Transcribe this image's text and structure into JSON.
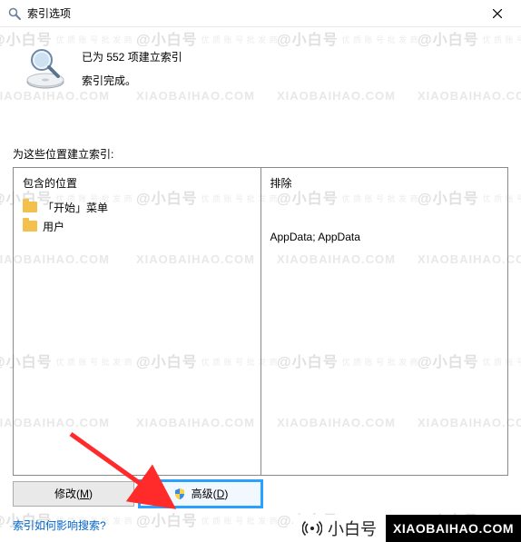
{
  "title": "索引选项",
  "status": {
    "line1": "已为 552 项建立索引",
    "line2": "索引完成。"
  },
  "section_label": "为这些位置建立索引:",
  "columns": {
    "included_header": "包含的位置",
    "excluded_header": "排除"
  },
  "included_locations": [
    {
      "label": "「开始」菜单"
    },
    {
      "label": "用户"
    }
  ],
  "excluded_text": "AppData; AppData",
  "buttons": {
    "modify": {
      "prefix": "修改(",
      "hotkey": "M",
      "suffix": ")"
    },
    "advanced": {
      "prefix": "高级(",
      "hotkey": "D",
      "suffix": ")"
    }
  },
  "help_link": "索引如何影响搜索?",
  "watermark": {
    "name": "@小白号",
    "tagline": "优 质 账 号 批 发 商",
    "url": "XIAOBAIHAO.COM"
  },
  "footer": {
    "cn": "小白号",
    "url": "XIAOBAIHAO.COM"
  }
}
